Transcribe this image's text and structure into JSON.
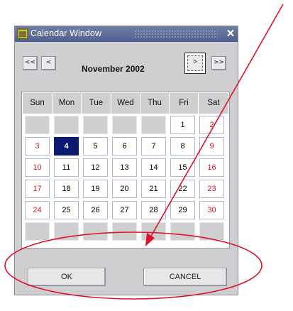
{
  "window": {
    "title": "Calendar Window",
    "close_glyph": "✕"
  },
  "nav": {
    "first_label": "<<",
    "prev_label": "<",
    "month_year": "November 2002",
    "next_label": ">",
    "last_label": ">>"
  },
  "weekdays": [
    "Sun",
    "Mon",
    "Tue",
    "Wed",
    "Thu",
    "Fri",
    "Sat"
  ],
  "days": {
    "d1": "1",
    "d2": "2",
    "d3": "3",
    "d4": "4",
    "d5": "5",
    "d6": "6",
    "d7": "7",
    "d8": "8",
    "d9": "9",
    "d10": "10",
    "d11": "11",
    "d12": "12",
    "d13": "13",
    "d14": "14",
    "d15": "15",
    "d16": "16",
    "d17": "17",
    "d18": "18",
    "d19": "19",
    "d20": "20",
    "d21": "21",
    "d22": "22",
    "d23": "23",
    "d24": "24",
    "d25": "25",
    "d26": "26",
    "d27": "27",
    "d28": "28",
    "d29": "29",
    "d30": "30"
  },
  "selected_day": "4",
  "buttons": {
    "ok_label": "OK",
    "cancel_label": "CANCEL"
  },
  "colors": {
    "weekend": "#e0122a",
    "selected_bg": "#0b1a70",
    "annotation": "#e0122a"
  }
}
